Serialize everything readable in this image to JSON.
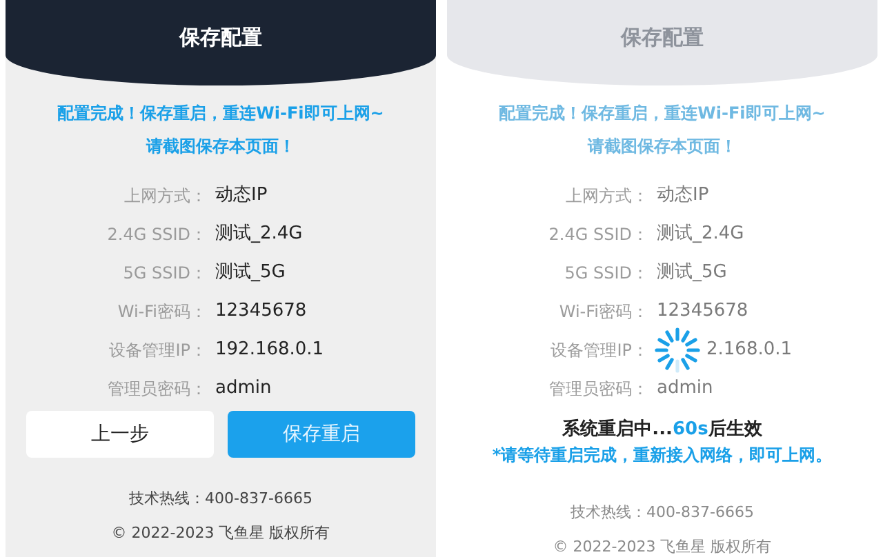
{
  "screens": [
    {
      "dimmed": false,
      "title": "保存配置",
      "notice": [
        "配置完成！保存重启，重连Wi-Fi即可上网~",
        "请截图保存本页面！"
      ],
      "fields": [
        {
          "label": "上网方式：",
          "value": "动态IP"
        },
        {
          "label": "2.4G SSID：",
          "value": "测试_2.4G"
        },
        {
          "label": "5G SSID：",
          "value": "测试_5G"
        },
        {
          "label": "Wi-Fi密码：",
          "value": "12345678"
        },
        {
          "label": "设备管理IP：",
          "value": "192.168.0.1"
        },
        {
          "label": "管理员密码：",
          "value": "admin"
        }
      ],
      "buttons": [
        {
          "label": "上一步",
          "kind": "secondary"
        },
        {
          "label": "保存重启",
          "kind": "primary"
        }
      ],
      "hotline": "技术热线：400-837-6665",
      "copyright": "© 2022-2023 飞鱼星 版权所有"
    },
    {
      "dimmed": true,
      "title": "保存配置",
      "notice": [
        "配置完成！保存重启，重连Wi-Fi即可上网~",
        "请截图保存本页面！"
      ],
      "fields": [
        {
          "label": "上网方式：",
          "value": "动态IP"
        },
        {
          "label": "2.4G SSID：",
          "value": "测试_2.4G"
        },
        {
          "label": "5G SSID：",
          "value": "测试_5G"
        },
        {
          "label": "Wi-Fi密码：",
          "value": "12345678"
        },
        {
          "label": "设备管理IP：",
          "value": "2.168.0.1",
          "kind": "spinner"
        },
        {
          "label": "管理员密码：",
          "value": "admin"
        }
      ],
      "overlay": {
        "status": "系统重启中...",
        "countdown": "60s",
        "status_end": "后生效",
        "note": "*请等待重启完成，重新接入网络，即可上网。"
      },
      "hotline": "技术热线：400-837-6665",
      "copyright": "© 2022-2023 飞鱼星 版权所有"
    }
  ]
}
